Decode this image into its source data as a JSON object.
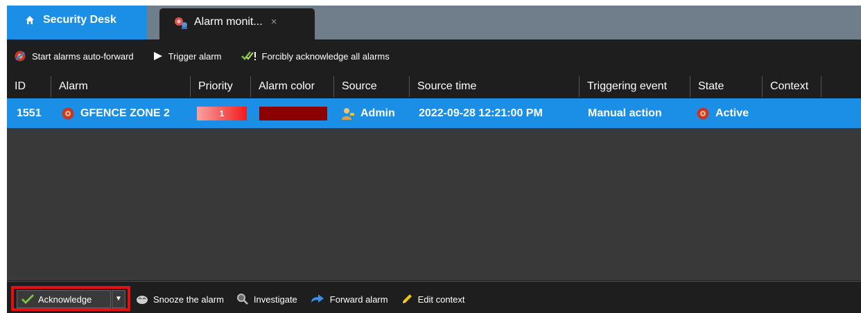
{
  "tabs": {
    "home_label": "Security Desk",
    "active_label": "Alarm monit...",
    "close_glyph": "×"
  },
  "toolbar": {
    "auto_forward_label": "Start alarms auto-forward",
    "trigger_label": "Trigger alarm",
    "force_ack_label": "Forcibly acknowledge all alarms"
  },
  "table": {
    "columns": [
      "ID",
      "Alarm",
      "Priority",
      "Alarm color",
      "Source",
      "Source time",
      "Triggering event",
      "State",
      "Context"
    ],
    "rows": [
      {
        "id": "1551",
        "alarm": "GFENCE ZONE 2",
        "priority": "1",
        "alarm_color": "#8b0000",
        "source": "Admin",
        "source_time": "2022-09-28 12:21:00 PM",
        "triggering_event": "Manual action",
        "state": "Active",
        "context": ""
      }
    ]
  },
  "actions": {
    "acknowledge_label": "Acknowledge",
    "dropdown_glyph": "▼",
    "snooze_label": "Snooze the alarm",
    "investigate_label": "Investigate",
    "forward_label": "Forward alarm",
    "edit_context_label": "Edit context"
  },
  "colors": {
    "accent_blue": "#1b8fe6",
    "tabbar_gray": "#707d8a",
    "highlight_red": "#e31010"
  },
  "icons": [
    "home-icon",
    "alarm-monitor-icon",
    "auto-forward-icon",
    "play-icon",
    "double-check-icon",
    "alarm-bell-icon",
    "user-icon",
    "check-icon",
    "snooze-icon",
    "magnifier-icon",
    "forward-arrow-icon",
    "pencil-icon"
  ]
}
